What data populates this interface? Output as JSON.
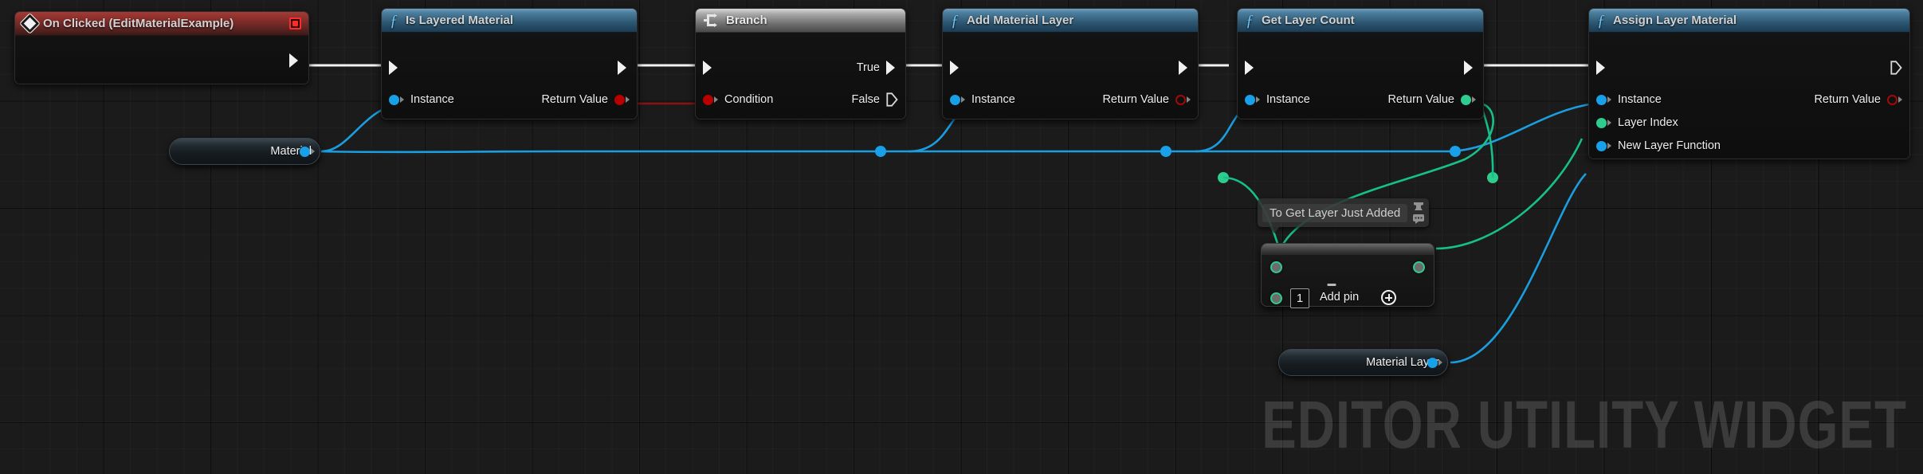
{
  "graph": {
    "watermark": "EDITOR UTILITY WIDGET",
    "colors": {
      "exec_wire": "#f2f2f2",
      "bool_wire": "#8c1212",
      "object_wire": "#1a9ee0",
      "int_wire": "#17c08a",
      "bool_pin": "#b80000",
      "object_pin": "#18a0e8",
      "int_pin": "#2ecc8f",
      "event_header": "#8a2f2b",
      "function_header": "#2b5570",
      "flow_header": "#6e6e6e"
    }
  },
  "nodes": {
    "on_clicked": {
      "title": "On Clicked (EditMaterialExample)",
      "icon": "event-diamond-icon",
      "delegate_icon": "red-square-delegate-icon",
      "outputs": [
        {
          "label": "",
          "type": "exec",
          "connected": true
        }
      ]
    },
    "is_layered_material": {
      "title": "Is Layered Material",
      "icon": "function-f-icon",
      "inputs": [
        {
          "label": "",
          "type": "exec",
          "connected": true
        },
        {
          "label": "Instance",
          "type": "object",
          "connected": true
        }
      ],
      "outputs": [
        {
          "label": "",
          "type": "exec",
          "connected": true
        },
        {
          "label": "Return Value",
          "type": "bool",
          "connected": true
        }
      ]
    },
    "branch": {
      "title": "Branch",
      "icon": "branch-flow-icon",
      "inputs": [
        {
          "label": "",
          "type": "exec",
          "connected": true
        },
        {
          "label": "Condition",
          "type": "bool",
          "connected": true
        }
      ],
      "outputs": [
        {
          "label": "True",
          "type": "exec",
          "connected": true
        },
        {
          "label": "False",
          "type": "exec",
          "connected": false
        }
      ]
    },
    "add_material_layer": {
      "title": "Add Material Layer",
      "icon": "function-f-icon",
      "inputs": [
        {
          "label": "",
          "type": "exec",
          "connected": true
        },
        {
          "label": "Instance",
          "type": "object",
          "connected": true
        }
      ],
      "outputs": [
        {
          "label": "",
          "type": "exec",
          "connected": true
        },
        {
          "label": "Return Value",
          "type": "bool",
          "connected": false
        }
      ]
    },
    "get_layer_count": {
      "title": "Get Layer Count",
      "icon": "function-f-icon",
      "inputs": [
        {
          "label": "",
          "type": "exec",
          "connected": true
        },
        {
          "label": "Instance",
          "type": "object",
          "connected": true
        }
      ],
      "outputs": [
        {
          "label": "",
          "type": "exec",
          "connected": true
        },
        {
          "label": "Return Value",
          "type": "int",
          "connected": true
        }
      ]
    },
    "assign_layer_material": {
      "title": "Assign Layer Material",
      "icon": "function-f-icon",
      "inputs": [
        {
          "label": "",
          "type": "exec",
          "connected": true
        },
        {
          "label": "Instance",
          "type": "object",
          "connected": true
        },
        {
          "label": "Layer Index",
          "type": "int",
          "connected": true
        },
        {
          "label": "New Layer Function",
          "type": "object",
          "connected": true
        }
      ],
      "outputs": [
        {
          "label": "",
          "type": "exec",
          "connected": false
        },
        {
          "label": "Return Value",
          "type": "bool",
          "connected": false
        }
      ]
    },
    "material_var": {
      "label": "Material",
      "pin_type": "object"
    },
    "material_layer_var": {
      "label": "Material Layer",
      "pin_type": "object"
    },
    "subtract": {
      "operator": "-",
      "operand_value": "1",
      "add_pin_label": "Add pin",
      "add_pin_icon": "plus-circle-icon",
      "comment": "To Get Layer Just Added",
      "comment_icons": [
        "pin-comment-icon",
        "speech-bubble-icon"
      ]
    }
  }
}
